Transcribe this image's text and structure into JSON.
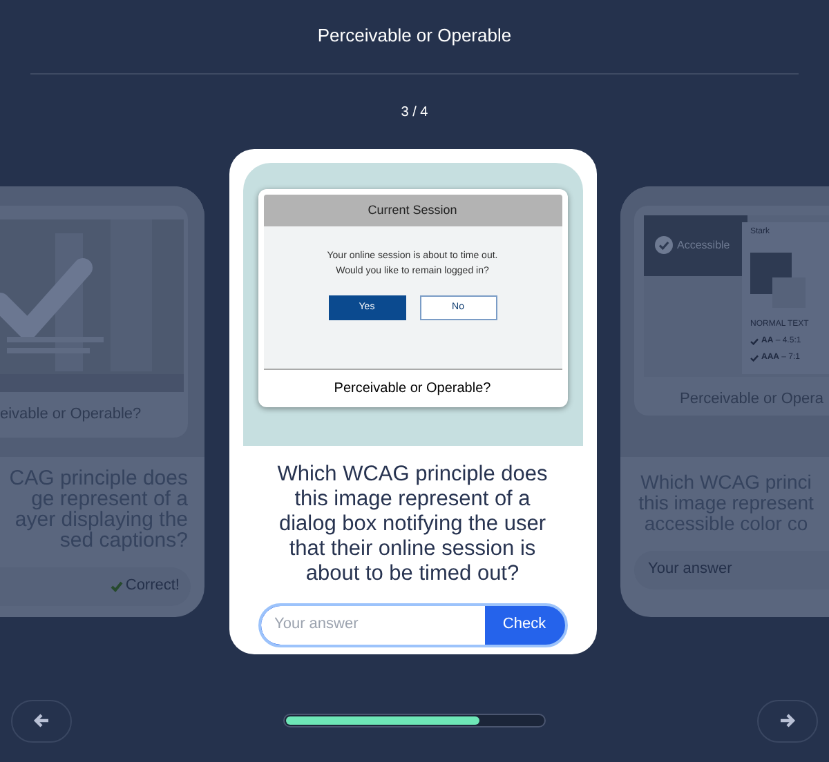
{
  "header": {
    "title": "Perceivable or Operable",
    "counter": "3 / 4"
  },
  "cards": [
    {
      "kind": "previous",
      "caption": "eivable or Operable?",
      "question_lines": [
        "CAG principle does",
        "ge represent of a",
        "ayer displaying the",
        "sed captions?"
      ],
      "status": "Correct!"
    },
    {
      "kind": "current",
      "dialog": {
        "title": "Current Session",
        "message_lines": [
          "Your online session is about to time out.",
          "Would you like to remain logged in?"
        ],
        "buttons": [
          {
            "label": "Yes",
            "selected": true
          },
          {
            "label": "No",
            "selected": false
          }
        ]
      },
      "caption": "Perceivable or Operable?",
      "question": "Which WCAG principle does this image represent of a dialog box notifying the user that their online session is about to be timed out?",
      "answer": {
        "placeholder": "Your answer"
      },
      "check_button": "Check"
    },
    {
      "kind": "next",
      "badge": "Accessible",
      "panel_title": "Stark",
      "panel_heading": "NORMAL TEXT",
      "ratios": [
        {
          "level": "AA",
          "value": "– 4.5:1"
        },
        {
          "level": "AAA",
          "value": "– 7:1"
        }
      ],
      "caption": "Perceivable or Opera",
      "question_lines": [
        "Which WCAG princi",
        "this image represent",
        "accessible color co"
      ],
      "answer": {
        "placeholder": "Your answer"
      }
    }
  ],
  "progress": {
    "level": 0.75
  }
}
